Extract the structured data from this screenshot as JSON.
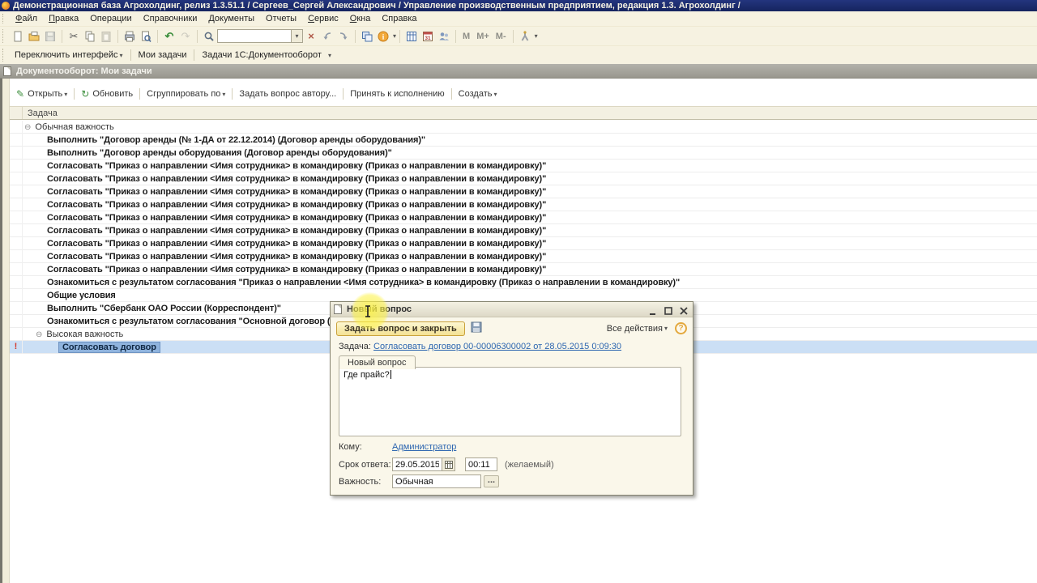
{
  "colors": {
    "titlebar": "#1b2a6b",
    "bar_bg": "#f6f2e1",
    "selection_row": "#cbdff5",
    "selection_cell": "#8fb3dd",
    "link": "#2d66b0",
    "primary_button": "#f4e193",
    "important": "#d4382b"
  },
  "app": {
    "title": "Демонстрационная база Агрохолдинг, релиз 1.3.51.1 / Сергеев_Сергей Александрович /  Управление производственным предприятием, редакция 1.3. Агрохолдинг /",
    "menu": [
      {
        "label": "Файл",
        "accel": true
      },
      {
        "label": "Правка",
        "accel": true
      },
      {
        "label": "Операции",
        "accel": false
      },
      {
        "label": "Справочники",
        "accel": false
      },
      {
        "label": "Документы",
        "accel": false
      },
      {
        "label": "Отчеты",
        "accel": false
      },
      {
        "label": "Сервис",
        "accel": true
      },
      {
        "label": "Окна",
        "accel": true
      },
      {
        "label": "Справка",
        "accel": false
      }
    ],
    "toolbar": {
      "search_value": "",
      "memory": [
        "M",
        "M+",
        "M-"
      ],
      "icons": [
        "new-document",
        "open",
        "save",
        "cut",
        "copy",
        "paste",
        "print",
        "print-preview",
        "undo",
        "redo",
        "search",
        "quick-search-combobox",
        "clear",
        "go-previous-link",
        "go-next-link",
        "window-copy",
        "info",
        "table-board",
        "calendar",
        "users",
        "service"
      ]
    },
    "interface_bar": {
      "switch_label": "Переключить интерфейс",
      "panels": [
        "Мои задачи",
        "Задачи 1С:Документооборот"
      ]
    }
  },
  "window": {
    "title": "Документооборот: Мои задачи",
    "actions": [
      {
        "label": "Открыть",
        "icon": "pencil",
        "caret": true
      },
      {
        "label": "Обновить",
        "icon": "refresh",
        "caret": false
      },
      {
        "label": "Сгруппировать по",
        "icon": null,
        "caret": true
      },
      {
        "label": "Задать вопрос автору...",
        "icon": null,
        "caret": false
      },
      {
        "label": "Принять к исполнению",
        "icon": null,
        "caret": false
      },
      {
        "label": "Создать",
        "icon": null,
        "caret": true
      }
    ],
    "column_header": "Задача",
    "rows": [
      {
        "type": "group",
        "level": 0,
        "label": "Обычная важность"
      },
      {
        "type": "item",
        "level": 1,
        "label": "Выполнить \"Договор аренды (№ 1-ДА от 22.12.2014) (Договор аренды оборудования)\""
      },
      {
        "type": "item",
        "level": 1,
        "label": "Выполнить \"Договор аренды оборудования (Договор аренды оборудования)\""
      },
      {
        "type": "item",
        "level": 1,
        "label": "Согласовать \"Приказ о направлении <Имя сотрудника> в командировку (Приказ о направлении в командировку)\""
      },
      {
        "type": "item",
        "level": 1,
        "label": "Согласовать \"Приказ о направлении <Имя сотрудника> в командировку (Приказ о направлении в командировку)\""
      },
      {
        "type": "item",
        "level": 1,
        "label": "Согласовать \"Приказ о направлении <Имя сотрудника> в командировку (Приказ о направлении в командировку)\""
      },
      {
        "type": "item",
        "level": 1,
        "label": "Согласовать \"Приказ о направлении <Имя сотрудника> в командировку (Приказ о направлении в командировку)\""
      },
      {
        "type": "item",
        "level": 1,
        "label": "Согласовать \"Приказ о направлении <Имя сотрудника> в командировку (Приказ о направлении в командировку)\""
      },
      {
        "type": "item",
        "level": 1,
        "label": "Согласовать \"Приказ о направлении <Имя сотрудника> в командировку (Приказ о направлении в командировку)\""
      },
      {
        "type": "item",
        "level": 1,
        "label": "Согласовать \"Приказ о направлении <Имя сотрудника> в командировку (Приказ о направлении в командировку)\""
      },
      {
        "type": "item",
        "level": 1,
        "label": "Согласовать \"Приказ о направлении <Имя сотрудника> в командировку (Приказ о направлении в командировку)\""
      },
      {
        "type": "item",
        "level": 1,
        "label": "Согласовать \"Приказ о направлении <Имя сотрудника> в командировку (Приказ о направлении в командировку)\""
      },
      {
        "type": "item",
        "level": 1,
        "label": "Ознакомиться с результатом согласования \"Приказ о направлении <Имя сотрудника> в командировку (Приказ о направлении в командировку)\""
      },
      {
        "type": "item",
        "level": 1,
        "label": "Общие условия"
      },
      {
        "type": "item",
        "level": 1,
        "label": "Выполнить \"Сбербанк  ОАО России (Корреспондент)\""
      },
      {
        "type": "item",
        "level": 1,
        "label": "Ознакомиться с результатом согласования \"Основной договор (Д"
      },
      {
        "type": "group",
        "level": 1,
        "label": "Высокая важность"
      },
      {
        "type": "item",
        "level": 2,
        "label": "Согласовать договор",
        "selected": true,
        "important": true
      }
    ]
  },
  "dialog": {
    "title": "Новый вопрос",
    "primary_button": "Задать вопрос и закрыть",
    "all_actions_label": "Все действия",
    "help_label": "?",
    "task_label": "Задача:",
    "task_link": "Согласовать договор 00-00006300002 от 28.05.2015 0:09:30",
    "tab_label": "Новый вопрос",
    "question_text": "Где прайс?",
    "to_label": "Кому:",
    "to_value": "Администратор",
    "deadline_label": "Срок ответа:",
    "deadline_date": "29.05.2015",
    "deadline_time": "00:11",
    "deadline_note": "(желаемый)",
    "importance_label": "Важность:",
    "importance_value": "Обычная",
    "more_button": "..."
  }
}
